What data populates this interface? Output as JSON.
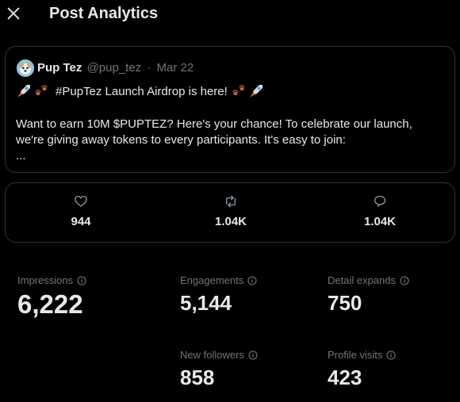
{
  "header": {
    "close_icon": "close-icon",
    "title": "Post Analytics"
  },
  "post": {
    "author_name": "Pup Tez",
    "author_handle": "@pup_tez",
    "separator": "·",
    "date": "Mar 22",
    "headline": "#PupTez Launch Airdrop is here!",
    "headline_emojis": [
      "rocket-emoji",
      "paw-prints-emoji",
      "paw-prints-emoji",
      "rocket-emoji"
    ],
    "body_line1": "Want to earn 10M $PUPTEZ? Here's your chance! To celebrate our launch,",
    "body_line2": "we're giving away tokens to every participants. It's easy to join:",
    "body_line3": "..."
  },
  "engagement_stats": {
    "likes": "944",
    "reposts": "1.04K",
    "replies": "1.04K"
  },
  "metrics": {
    "impressions_label": "Impressions",
    "impressions_value": "6,222",
    "engagements_label": "Engagements",
    "engagements_value": "5,144",
    "detail_expands_label": "Detail expands",
    "detail_expands_value": "750",
    "new_followers_label": "New followers",
    "new_followers_value": "858",
    "profile_visits_label": "Profile visits",
    "profile_visits_value": "423"
  },
  "colors": {
    "background": "#000000",
    "text_primary": "#e7e9ea",
    "text_secondary": "#71767b",
    "border": "#2f3336"
  }
}
